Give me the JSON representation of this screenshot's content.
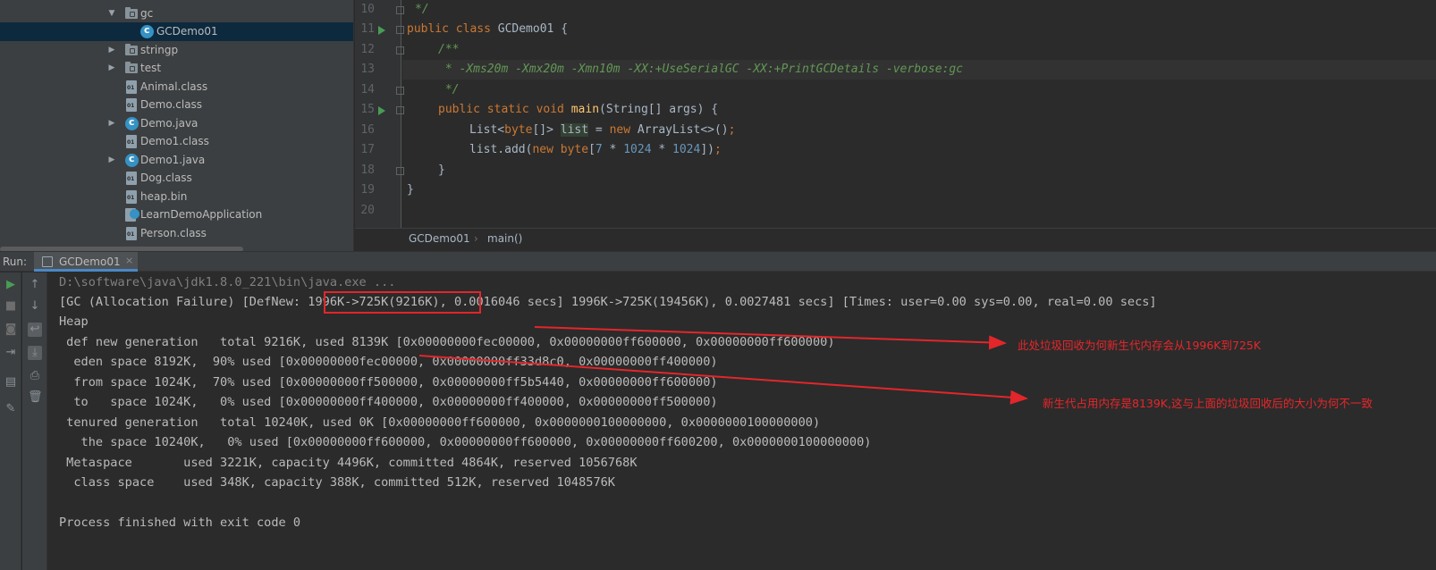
{
  "tree": {
    "items": [
      {
        "label": "gc",
        "icon": "folder-icon",
        "expanded": true
      },
      {
        "label": "GCDemo01",
        "icon": "java-class-icon",
        "selected": true
      },
      {
        "label": "stringp",
        "icon": "folder-icon",
        "expanded": false
      },
      {
        "label": "test",
        "icon": "folder-icon",
        "expanded": false
      },
      {
        "label": "Animal.class",
        "icon": "class-file-icon"
      },
      {
        "label": "Demo.class",
        "icon": "class-file-icon"
      },
      {
        "label": "Demo.java",
        "icon": "java-file-icon",
        "expanded": false
      },
      {
        "label": "Demo1.class",
        "icon": "class-file-icon"
      },
      {
        "label": "Demo1.java",
        "icon": "java-file-icon",
        "expanded": false
      },
      {
        "label": "Dog.class",
        "icon": "class-file-icon"
      },
      {
        "label": "heap.bin",
        "icon": "binary-file-icon"
      },
      {
        "label": "LearnDemoApplication",
        "icon": "spring-app-icon"
      },
      {
        "label": "Person.class",
        "icon": "class-file-icon"
      }
    ]
  },
  "editor": {
    "line_numbers": [
      "10",
      "11",
      "12",
      "13",
      "14",
      "15",
      "16",
      "17",
      "18",
      "19",
      "20"
    ],
    "lines": {
      "l10": {
        "c": "*/"
      },
      "l11": {
        "k1": "public class ",
        "p": "GCDemo01 {"
      },
      "l12": {
        "c": "/**"
      },
      "l13": {
        "c": " * -Xms20m -Xmx20m -Xmn10m -XX:+UseSerialGC -XX:+PrintGCDetails -verbose:gc"
      },
      "l14": {
        "c": " */"
      },
      "l15": {
        "k": "public static void ",
        "f": "main",
        "p": "(String[] args) {"
      },
      "l16": {
        "p1": "List<",
        "k": "byte",
        "p2": "[]> ",
        "v": "list",
        "p3": " = ",
        "k2": "new ",
        "p4": "ArrayList<>()",
        "k3": ";"
      },
      "l17": {
        "p1": "list.add(",
        "k": "new byte",
        "p2": "[",
        "n1": "7",
        "p3": " * ",
        "n2": "1024",
        "p4": " * ",
        "n3": "1024",
        "p5": "])",
        "k3": ";"
      },
      "l18": {
        "p": "}"
      },
      "l19": {
        "p": "}"
      }
    },
    "breadcrumbs": {
      "class": "GCDemo01",
      "separator": "›",
      "method": "main()"
    }
  },
  "run": {
    "label": "Run:",
    "tab_label": "GCDemo01",
    "close": "×",
    "console": [
      "D:\\software\\java\\jdk1.8.0_221\\bin\\java.exe ...",
      "[GC (Allocation Failure) [DefNew: 1996K->725K(9216K), 0.0016046 secs] 1996K->725K(19456K), 0.0027481 secs] [Times: user=0.00 sys=0.00, real=0.00 secs]",
      "Heap",
      " def new generation   total 9216K, used 8139K [0x00000000fec00000, 0x00000000ff600000, 0x00000000ff600000)",
      "  eden space 8192K,  90% used [0x00000000fec00000, 0x00000000ff33d8c0, 0x00000000ff400000)",
      "  from space 1024K,  70% used [0x00000000ff500000, 0x00000000ff5b5440, 0x00000000ff600000)",
      "  to   space 1024K,   0% used [0x00000000ff400000, 0x00000000ff400000, 0x00000000ff500000)",
      " tenured generation   total 10240K, used 0K [0x00000000ff600000, 0x0000000100000000, 0x0000000100000000)",
      "   the space 10240K,   0% used [0x00000000ff600000, 0x00000000ff600000, 0x00000000ff600200, 0x0000000100000000)",
      " Metaspace       used 3221K, capacity 4496K, committed 4864K, reserved 1056768K",
      "  class space    used 348K, capacity 388K, committed 512K, reserved 1048576K",
      "",
      "Process finished with exit code 0"
    ]
  },
  "annotations": {
    "note1": "此处垃圾回收为何新生代内存会从1996K到725K",
    "note2": "新生代占用内存是8139K,这与上面的垃圾回收后的大小为何不一致",
    "color": "#e3262a"
  }
}
